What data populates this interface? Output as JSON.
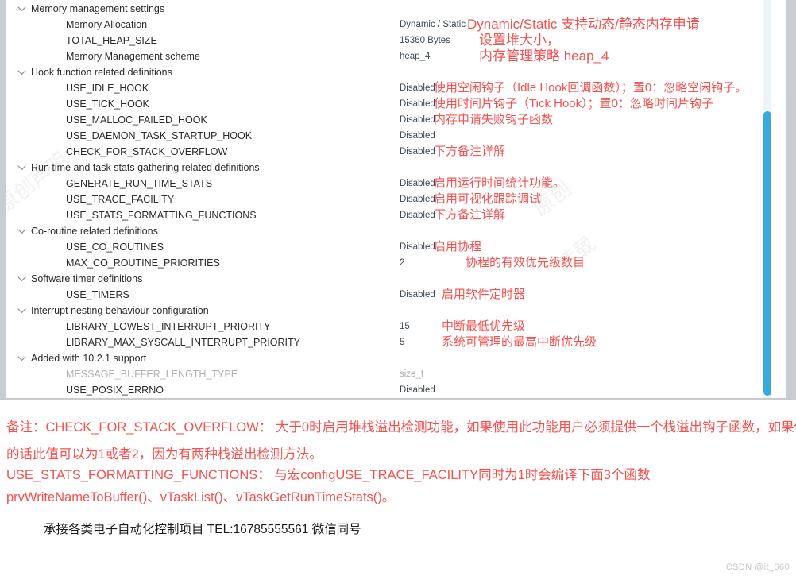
{
  "panel": {
    "scrollbar": {
      "orientation": "vertical",
      "thumb_color": "#37a9dd"
    }
  },
  "colors": {
    "annotation_red": "#f2524f",
    "value_text": "#3e4a57",
    "disabled_text": "#b2b2b2",
    "scroll_thumb": "#37a9dd"
  },
  "tree": [
    {
      "kind": "group",
      "label": "Memory management settings",
      "expanded": true,
      "value": "",
      "annotation": ""
    },
    {
      "kind": "leaf",
      "label": "Memory Allocation",
      "value": "Dynamic / Static",
      "annotation": "Dynamic/Static 支持动态/静态内存申请"
    },
    {
      "kind": "leaf",
      "label": "TOTAL_HEAP_SIZE",
      "value": "15360 Bytes",
      "annotation": "设置堆大小，"
    },
    {
      "kind": "leaf",
      "label": "Memory Management scheme",
      "value": "heap_4",
      "annotation": "内存管理策略 heap_4"
    },
    {
      "kind": "group",
      "label": "Hook function related definitions",
      "expanded": true,
      "value": "",
      "annotation": ""
    },
    {
      "kind": "leaf",
      "label": "USE_IDLE_HOOK",
      "value": "Disabled",
      "annotation": "使用空闲钩子（Idle Hook回调函数）；置0：忽略空闲钩子。"
    },
    {
      "kind": "leaf",
      "label": "USE_TICK_HOOK",
      "value": "Disabled",
      "annotation": "使用时间片钩子（Tick Hook）；置0：忽略时间片钩子"
    },
    {
      "kind": "leaf",
      "label": "USE_MALLOC_FAILED_HOOK",
      "value": "Disabled",
      "annotation": "内存申请失败钩子函数"
    },
    {
      "kind": "leaf",
      "label": "USE_DAEMON_TASK_STARTUP_HOOK",
      "value": "Disabled",
      "annotation": ""
    },
    {
      "kind": "leaf",
      "label": "CHECK_FOR_STACK_OVERFLOW",
      "value": "Disabled",
      "annotation": "下方备注详解"
    },
    {
      "kind": "group",
      "label": "Run time and task stats gathering related definitions",
      "expanded": true,
      "value": "",
      "annotation": ""
    },
    {
      "kind": "leaf",
      "label": "GENERATE_RUN_TIME_STATS",
      "value": "Disabled",
      "annotation": "启用运行时间统计功能。"
    },
    {
      "kind": "leaf",
      "label": "USE_TRACE_FACILITY",
      "value": "Disabled",
      "annotation": "启用可视化跟踪调试"
    },
    {
      "kind": "leaf",
      "label": "USE_STATS_FORMATTING_FUNCTIONS",
      "value": "Disabled",
      "annotation": "下方备注详解"
    },
    {
      "kind": "group",
      "label": "Co-routine related definitions",
      "expanded": true,
      "value": "",
      "annotation": ""
    },
    {
      "kind": "leaf",
      "label": "USE_CO_ROUTINES",
      "value": "Disabled",
      "annotation": "启用协程"
    },
    {
      "kind": "leaf",
      "label": "MAX_CO_ROUTINE_PRIORITIES",
      "value": "2",
      "annotation": "协程的有效优先级数目"
    },
    {
      "kind": "group",
      "label": "Software timer definitions",
      "expanded": true,
      "value": "",
      "annotation": ""
    },
    {
      "kind": "leaf",
      "label": "USE_TIMERS",
      "value": "Disabled",
      "annotation": "启用软件定时器"
    },
    {
      "kind": "group",
      "label": "Interrupt nesting behaviour configuration",
      "expanded": true,
      "value": "",
      "annotation": ""
    },
    {
      "kind": "leaf",
      "label": "LIBRARY_LOWEST_INTERRUPT_PRIORITY",
      "value": "15",
      "annotation": "中断最低优先级"
    },
    {
      "kind": "leaf",
      "label": "LIBRARY_MAX_SYSCALL_INTERRUPT_PRIORITY",
      "value": "5",
      "annotation": "系统可管理的最高中断优先级"
    },
    {
      "kind": "group",
      "label": "Added with 10.2.1 support",
      "expanded": true,
      "value": "",
      "annotation": ""
    },
    {
      "kind": "leaf",
      "label": "MESSAGE_BUFFER_LENGTH_TYPE",
      "value": "size_t",
      "annotation": "",
      "disabled": true
    },
    {
      "kind": "leaf",
      "label": "USE_POSIX_ERRNO",
      "value": "Disabled",
      "annotation": ""
    }
  ],
  "notes": [
    "备注：CHECK_FOR_STACK_OVERFLOW： 大于0时启用堆栈溢出检测功能，如果使用此功能用户必须提供一个栈溢出钩子函数，如果使用",
    "的话此值可以为1或者2，因为有两种栈溢出检测方法。",
    "        USE_STATS_FORMATTING_FUNCTIONS： 与宏configUSE_TRACE_FACILITY同时为1时会编译下面3个函数",
    "prvWriteNameToBuffer()、vTaskList()、vTaskGetRunTimeStats()。"
  ],
  "contact": "承接各类电子自动化控制项目    TEL:16785555561  微信同号",
  "watermark": "CSDN @it_660"
}
